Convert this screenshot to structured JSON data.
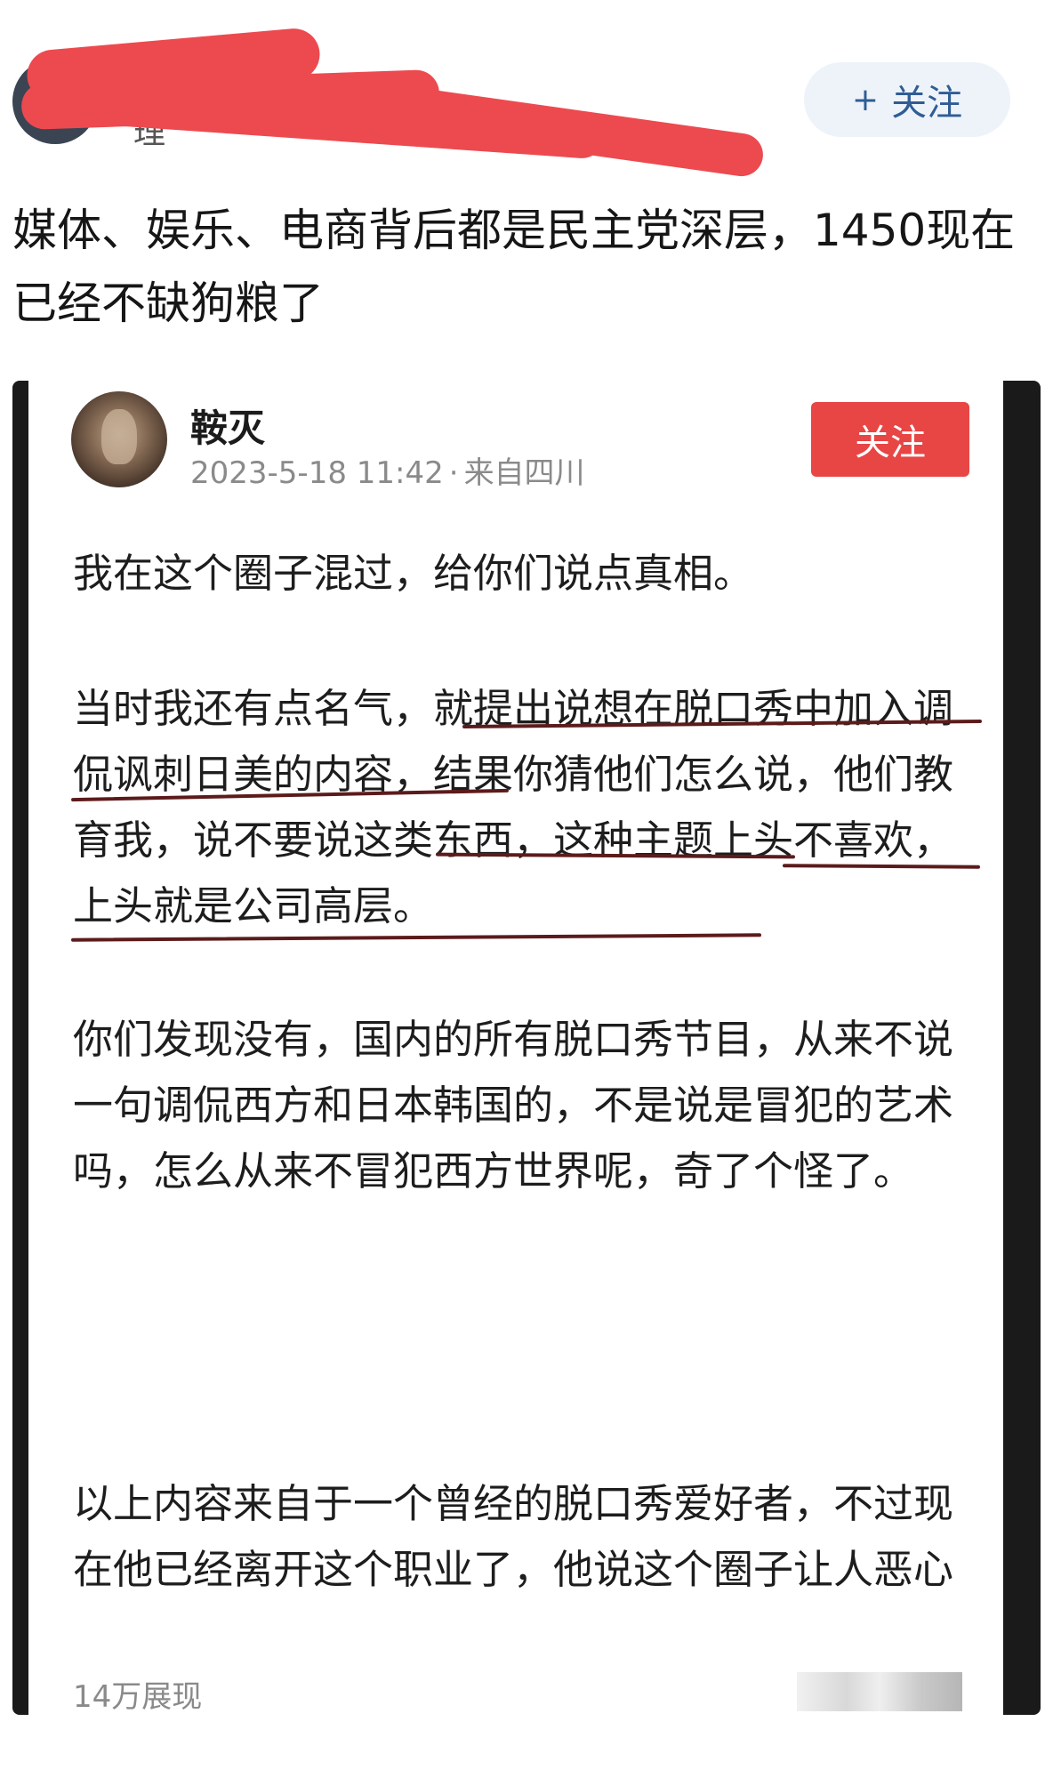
{
  "outer_post": {
    "username": "理",
    "follow_label": "关注",
    "follow_icon": "plus-icon",
    "text": "媒体、娱乐、电商背后都是民主党深层，1450现在\n已经不缺狗粮了"
  },
  "quoted_post": {
    "author": "鞍灭",
    "timestamp": "2023-5-18 11:42",
    "location": "来自四川",
    "meta_separator": "·",
    "follow_label": "关注",
    "paragraphs": [
      "我在这个圈子混过，给你们说点真相。",
      "当时我还有点名气，就提出说想在脱口秀中加入调侃讽刺日美的内容，结果你猜他们怎么说，他们教育我，说不要说这类东西，这种主题上头不喜欢，上头就是公司高层。",
      "你们发现没有，国内的所有脱口秀节目，从来不说一句调侃西方和日本韩国的，不是说是冒犯的艺术吗，怎么从来不冒犯西方世界呢，奇了个怪了。",
      "以上内容来自于一个曾经的脱口秀爱好者，不过现在他已经离开这个职业了，他说这个圈子让人恶心"
    ],
    "views": "14万展现"
  },
  "colors": {
    "redaction": "#ec4a4f",
    "follow_red": "#e84545",
    "follow_outer_bg": "#eef3fa",
    "follow_outer_text": "#2f5d94",
    "meta_gray": "#8a8a8a"
  }
}
